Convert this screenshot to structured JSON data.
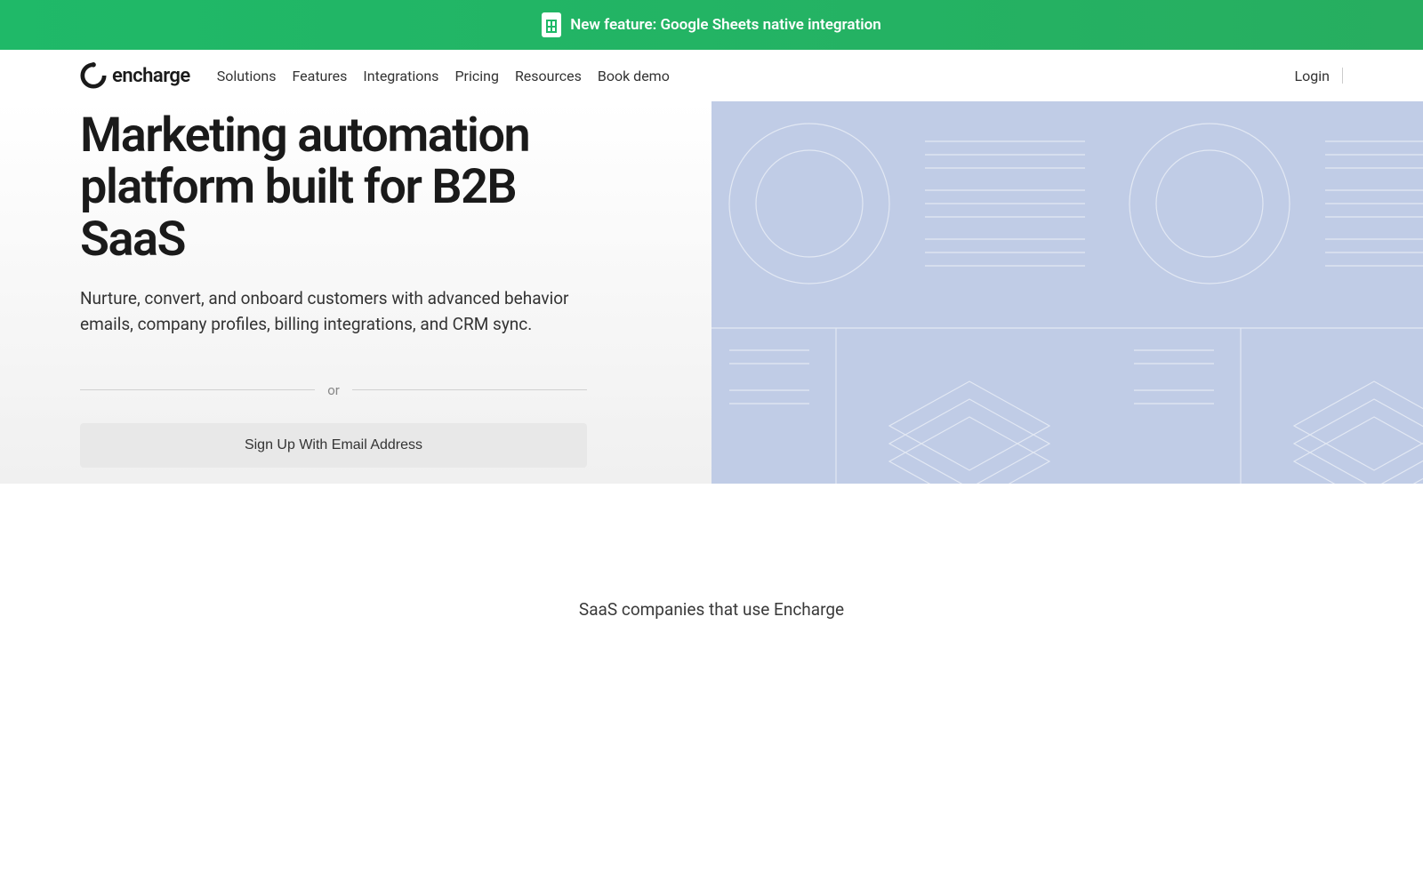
{
  "announcement": {
    "text": "New feature: Google Sheets native integration"
  },
  "brand": {
    "name": "encharge"
  },
  "nav": {
    "items": [
      {
        "label": "Solutions"
      },
      {
        "label": "Features"
      },
      {
        "label": "Integrations"
      },
      {
        "label": "Pricing"
      },
      {
        "label": "Resources"
      },
      {
        "label": "Book demo"
      }
    ],
    "login": "Login"
  },
  "hero": {
    "title": "Marketing automation platform built for B2B SaaS",
    "subtitle": "Nurture, convert, and onboard customers with advanced behavior emails, company profiles, billing integrations, and CRM sync.",
    "or": "or",
    "email_signup": "Sign Up With Email Address"
  },
  "social_proof": {
    "heading": "SaaS companies that use Encharge"
  }
}
